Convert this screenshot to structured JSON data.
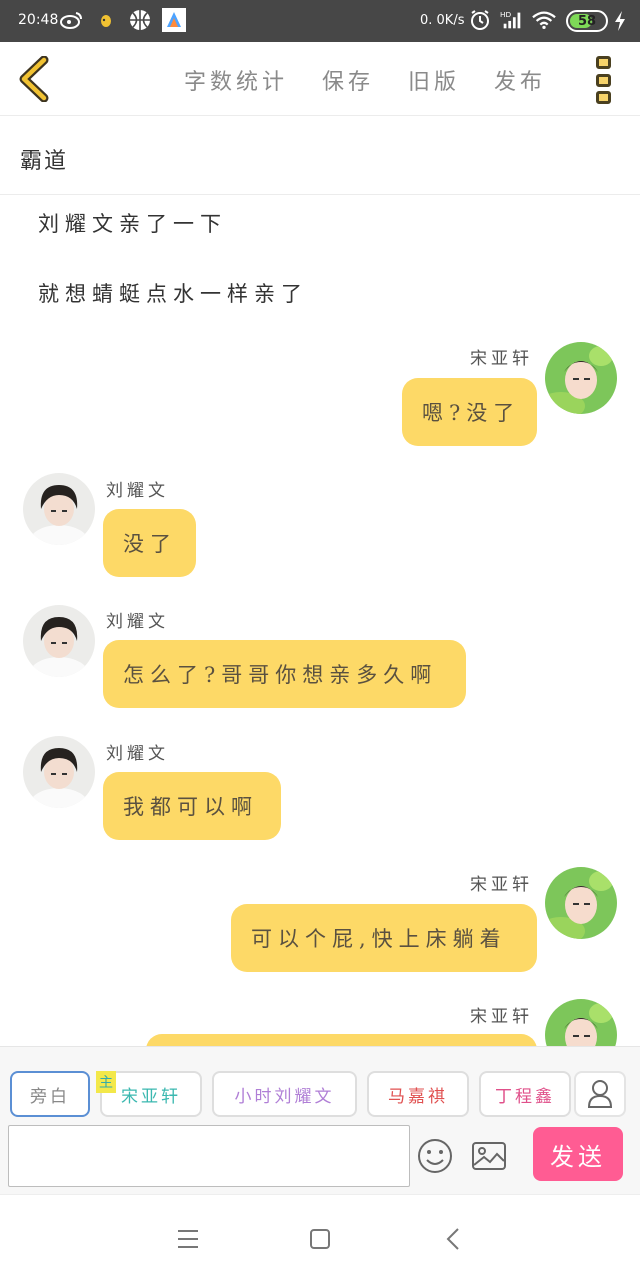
{
  "status_bar": {
    "time": "20:48",
    "speed": "0. 0K/s",
    "battery": "58",
    "battery_level": 0.58,
    "icons_left": [
      "weibo-icon",
      "app-icon",
      "basketball-icon",
      "app-store-icon"
    ],
    "icons_right": [
      "alarm-icon",
      "hd-signal-icon",
      "wifi-icon",
      "battery-icon",
      "charging-icon"
    ]
  },
  "top_bar": {
    "word_count": "字数统计",
    "save": "保存",
    "old_version": "旧版",
    "publish": "发布"
  },
  "title": "霸道",
  "narration": [
    "刘耀文亲了一下",
    "就想蜻蜓点水一样亲了"
  ],
  "messages": [
    {
      "speaker": "宋亚轩",
      "side": "right",
      "text": "嗯?没了"
    },
    {
      "speaker": "刘耀文",
      "side": "left",
      "text": "没了"
    },
    {
      "speaker": "刘耀文",
      "side": "left",
      "text": "怎么了?哥哥你想亲多久啊"
    },
    {
      "speaker": "刘耀文",
      "side": "left",
      "text": "我都可以啊"
    },
    {
      "speaker": "宋亚轩",
      "side": "right",
      "text": "可以个屁,快上床躺着"
    },
    {
      "speaker": "宋亚轩",
      "side": "right",
      "text": ""
    }
  ],
  "role_tabs": [
    {
      "label": "旁白",
      "color": "#999999"
    },
    {
      "label": "宋亚轩",
      "color": "#3bb8b0"
    },
    {
      "label": "小时刘耀文",
      "color": "#b07fd6"
    },
    {
      "label": "马嘉祺",
      "color": "#e05050"
    },
    {
      "label": "丁程鑫",
      "color": "#e0508a"
    }
  ],
  "main_badge": "主",
  "send": "发送",
  "colors": {
    "bubble": "#fdd967",
    "accent_back": "#f1c232",
    "send_button": "#ff5c93"
  }
}
